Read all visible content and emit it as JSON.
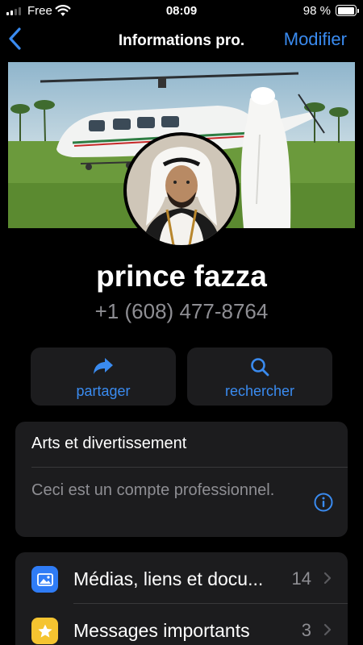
{
  "status_bar": {
    "carrier": "Free",
    "time": "08:09",
    "battery_percent": "98 %",
    "battery_level": 0.98
  },
  "nav": {
    "title": "Informations pro.",
    "edit_label": "Modifier"
  },
  "profile": {
    "name": "prince fazza",
    "phone": "+1 (608) 477-8764"
  },
  "actions": {
    "share_label": "partager",
    "search_label": "rechercher"
  },
  "business_info": {
    "category": "Arts et divertissement",
    "note": "Ceci est un compte professionnel."
  },
  "list": {
    "media": {
      "label": "Médias, liens et docu...",
      "count": "14"
    },
    "starred": {
      "label": "Messages importants",
      "count": "3"
    }
  },
  "colors": {
    "accent": "#3a8bf0",
    "background": "#000000",
    "card": "#1c1c1e",
    "secondary_text": "#8e8e93",
    "media_icon": "#2f7cf6",
    "star_icon": "#f5c430"
  }
}
